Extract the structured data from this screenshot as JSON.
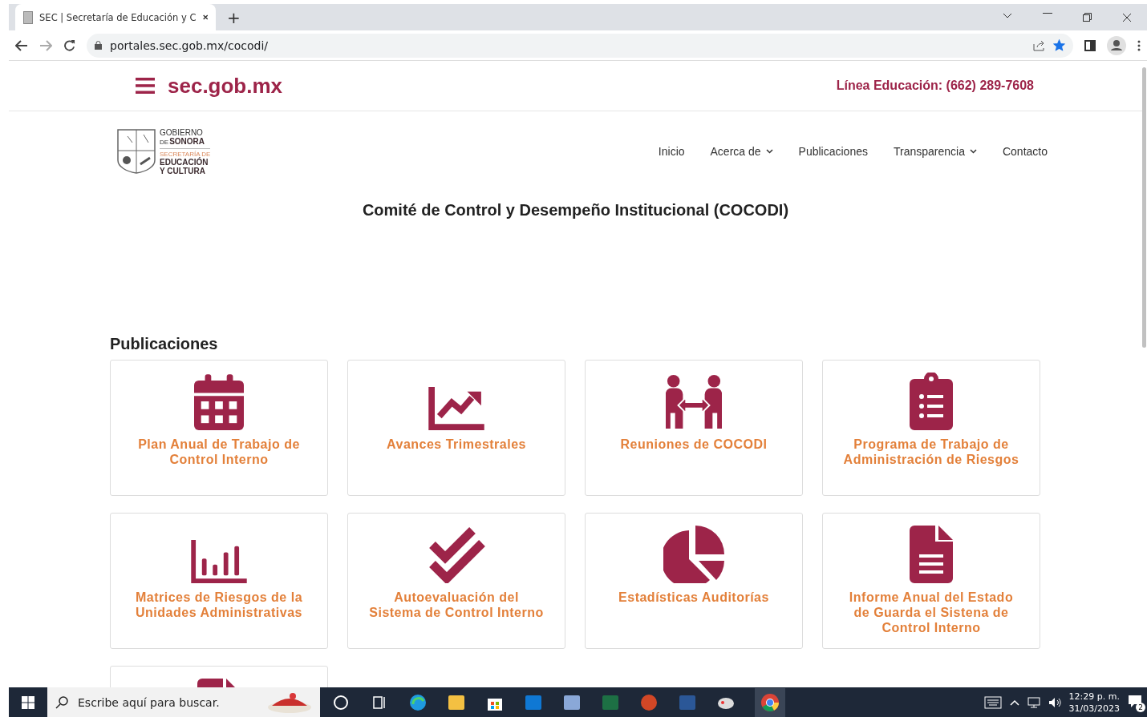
{
  "browser": {
    "tab_title": "SEC | Secretaría de Educación y C",
    "new_tab": "+",
    "url": "portales.sec.gob.mx/cocodi/",
    "bookmarked": true
  },
  "header": {
    "brand": "sec.gob.mx",
    "phone": "Línea Educación: (662) 289-7608"
  },
  "logo": {
    "line_1": "GOBIERNO",
    "line_2_small": "DE",
    "line_2": "SONORA",
    "line_3": "SECRETARÍA DE",
    "line_4": "EDUCACIÓN",
    "line_5": "Y CULTURA"
  },
  "nav": [
    {
      "label": "Inicio",
      "has_dropdown": false
    },
    {
      "label": "Acerca de",
      "has_dropdown": true
    },
    {
      "label": "Publicaciones",
      "has_dropdown": false
    },
    {
      "label": "Transparencia",
      "has_dropdown": true
    },
    {
      "label": "Contacto",
      "has_dropdown": false
    }
  ],
  "page_title": "Comité de Control y Desempeño Institucional (COCODI)",
  "section_heading": "Publicaciones",
  "cards": [
    {
      "kind": "calendar",
      "title": "Plan Anual de Trabajo de\nControl Interno"
    },
    {
      "kind": "line-chart",
      "title": "Avances Trimestrales"
    },
    {
      "kind": "people",
      "title": "Reuniones de COCODI"
    },
    {
      "kind": "clipboard",
      "title": "Programa de Trabajo de\nAdministración de Riesgos"
    },
    {
      "kind": "bar-chart",
      "title": "Matrices de Riesgos de la\nUnidades Administrativas"
    },
    {
      "kind": "double-check",
      "title": "Autoevaluación del\nSistema de Control Interno"
    },
    {
      "kind": "pie-chart",
      "title": "Estadísticas Auditorías"
    },
    {
      "kind": "document",
      "title": "Informe Anual del Estado\nde Guarda el Sistena de\nControl Interno"
    },
    {
      "kind": "document"
    }
  ],
  "taskbar": {
    "search_placeholder": "Escribe aquí para buscar.",
    "time": "12:29 p. m.",
    "date": "31/03/2023",
    "notifications": "2"
  }
}
